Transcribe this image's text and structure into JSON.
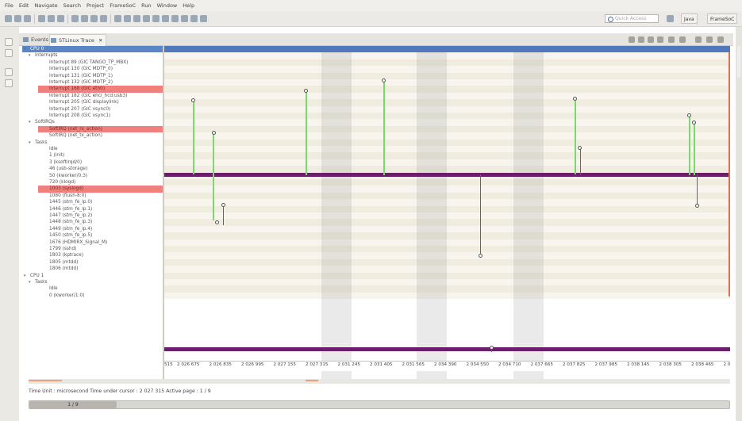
{
  "menu": [
    "File",
    "Edit",
    "Navigate",
    "Search",
    "Project",
    "FrameSoC",
    "Run",
    "Window",
    "Help"
  ],
  "toolbar": {
    "quick_access": "Quick Access",
    "persp_java": "Java",
    "persp_framesoc": "FrameSoC"
  },
  "tabs": {
    "events": "Events",
    "trace": "STLinux Trace"
  },
  "tree": [
    {
      "label": "CPU 0",
      "level": 0,
      "tw": true
    },
    {
      "label": "Interrupts",
      "level": 1,
      "tw": true
    },
    {
      "label": "Interrupt 89 (GIC TANGO_TP_MBX)",
      "level": 2
    },
    {
      "label": "Interrupt 130 (GIC MDTP_0)",
      "level": 2
    },
    {
      "label": "Interrupt 131 (GIC MDTP_1)",
      "level": 2
    },
    {
      "label": "Interrupt 132 (GIC MDTP_2)",
      "level": 2
    },
    {
      "label": "Interrupt 168 (GIC eth0)",
      "level": 2,
      "sel": true
    },
    {
      "label": "Interrupt 182 (GIC ehci_hcd:usb3)",
      "level": 2
    },
    {
      "label": "Interrupt 205 (GIC displaylink)",
      "level": 2
    },
    {
      "label": "Interrupt 207 (GIC vsync0)",
      "level": 2
    },
    {
      "label": "Interrupt 208 (GIC vsync1)",
      "level": 2
    },
    {
      "label": "SoftIRQs",
      "level": 1,
      "tw": true
    },
    {
      "label": "SoftIRQ (net_rx_action)",
      "level": 2,
      "sel": true
    },
    {
      "label": "SoftIRQ (net_tx_action)",
      "level": 2
    },
    {
      "label": "Tasks",
      "level": 1,
      "tw": true
    },
    {
      "label": "Idle",
      "level": 2
    },
    {
      "label": "1 (init)",
      "level": 2
    },
    {
      "label": "3 (ksoftirqd/0)",
      "level": 2
    },
    {
      "label": "46 (usb-storage)",
      "level": 2
    },
    {
      "label": "50 (kworker/0:3)",
      "level": 2
    },
    {
      "label": "720 (klogd)",
      "level": 2
    },
    {
      "label": "1003 (syslogd)",
      "level": 2,
      "sel": true
    },
    {
      "label": "1080 (flush-8:0)",
      "level": 2
    },
    {
      "label": "1445 (stm_fe_ip.0)",
      "level": 2
    },
    {
      "label": "1446 (stm_fe_ip.1)",
      "level": 2
    },
    {
      "label": "1447 (stm_fe_ip.2)",
      "level": 2
    },
    {
      "label": "1448 (stm_fe_ip.3)",
      "level": 2
    },
    {
      "label": "1449 (stm_fe_ip.4)",
      "level": 2
    },
    {
      "label": "1450 (stm_fe_ip.5)",
      "level": 2
    },
    {
      "label": "1676 (HDMIRX_Signal_M)",
      "level": 2
    },
    {
      "label": "1799 (sshd)",
      "level": 2
    },
    {
      "label": "1803 (kptrace)",
      "level": 2
    },
    {
      "label": "1805 (mtdd)",
      "level": 2
    },
    {
      "label": "1806 (mtdd)",
      "level": 2
    },
    {
      "label": "CPU 1",
      "level": 0,
      "tw": true
    },
    {
      "label": "Tasks",
      "level": 1,
      "tw": true
    },
    {
      "label": "Idle",
      "level": 2
    },
    {
      "label": "0 (kworker/1:0)",
      "level": 2
    }
  ],
  "axis_ticks": [
    "515",
    "2 026 675",
    "2 026 835",
    "2 026 995",
    "2 027 155",
    "2 027 315",
    "2 031 245",
    "2 031 405",
    "2 031 565",
    "2 034 390",
    "2 034 550",
    "2 034 710",
    "2 037 665",
    "2 037 825",
    "2 037 985",
    "2 038 145",
    "2 038 305",
    "2 038 465",
    "2 0"
  ],
  "status": "Time Unit : microsecond   Time under cursor : 2 027 315   Active page : 1 / 9",
  "page_indicator": "1 / 9",
  "colors": {
    "selected": "#f0807d",
    "state_bar": "#6b1e6a",
    "link": "#7bd96b",
    "header": "#5079bd"
  }
}
